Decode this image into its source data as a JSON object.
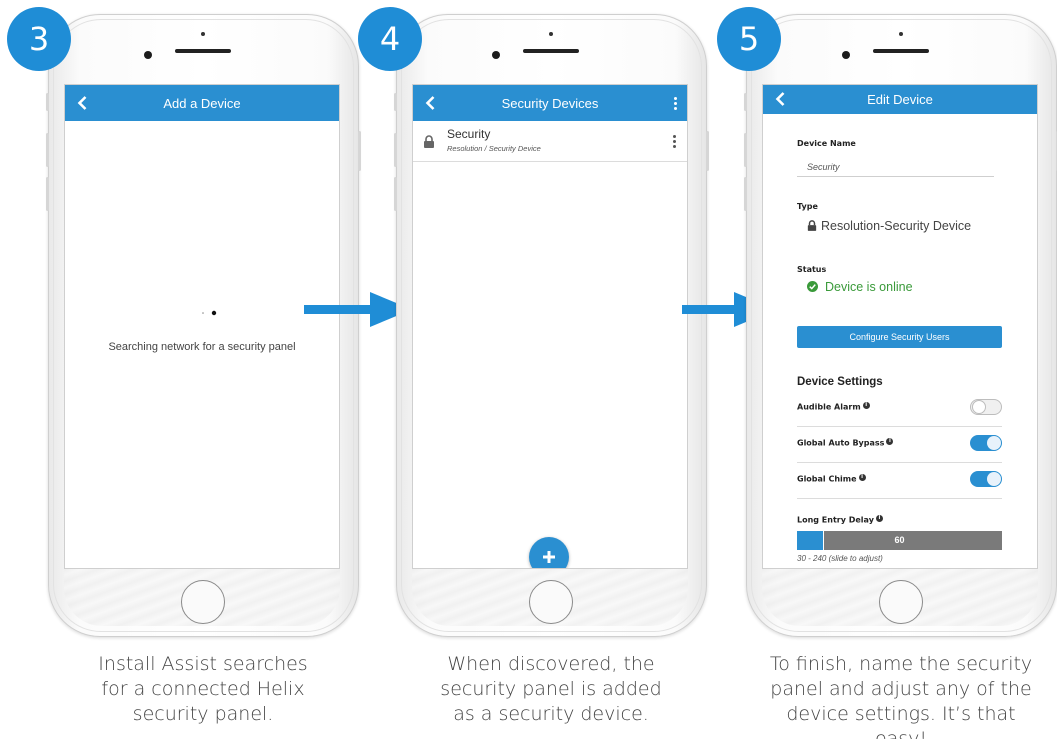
{
  "steps": [
    {
      "number": "3",
      "caption": "Install Assist searches for a connected Helix security panel."
    },
    {
      "number": "4",
      "caption": "When discovered, the security panel is added as a security device."
    },
    {
      "number": "5",
      "caption": "To finish, name the security panel and adjust any of the device settings. It’s that easy!"
    }
  ],
  "screen1": {
    "title": "Add a Device",
    "status_text": "Searching network for a security panel"
  },
  "screen2": {
    "title": "Security Devices",
    "device": {
      "name": "Security",
      "subtitle": "Resolution / Security Device"
    }
  },
  "screen3": {
    "title": "Edit Device",
    "device_name_label": "Device Name",
    "device_name_value": "Security",
    "type_label": "Type",
    "type_value": "Resolution-Security Device",
    "status_label": "Status",
    "status_value": "Device is online",
    "configure_button": "Configure Security Users",
    "settings_title": "Device Settings",
    "settings": [
      {
        "label": "Audible Alarm",
        "on": false
      },
      {
        "label": "Global Auto Bypass",
        "on": true
      },
      {
        "label": "Global Chime",
        "on": true
      }
    ],
    "long_entry_delay_label": "Long Entry Delay",
    "long_entry_delay_value": "60",
    "long_entry_delay_fraction": 0.13,
    "long_entry_delay_hint": "30 - 240 (slide to adjust)"
  },
  "colors": {
    "accent": "#2a8fd1",
    "badge": "#1f8dd6",
    "online": "#3a9a3a"
  },
  "icons": [
    "back-arrow-icon",
    "kebab-menu-icon",
    "lock-icon",
    "check-circle-icon",
    "plus-icon",
    "info-icon",
    "right-arrow-icon"
  ]
}
